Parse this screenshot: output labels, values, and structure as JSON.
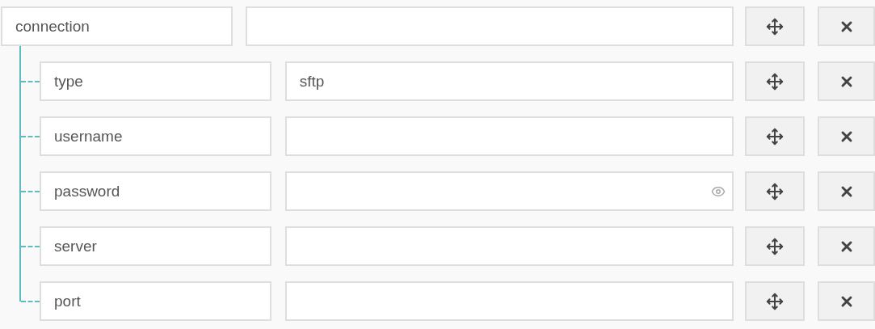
{
  "root": {
    "key": "connection",
    "children": [
      {
        "key": "type",
        "value": "sftp",
        "kind": "text"
      },
      {
        "key": "username",
        "kind": "text"
      },
      {
        "key": "password",
        "kind": "password"
      },
      {
        "key": "server",
        "kind": "text"
      },
      {
        "key": "port",
        "kind": "text"
      }
    ]
  }
}
